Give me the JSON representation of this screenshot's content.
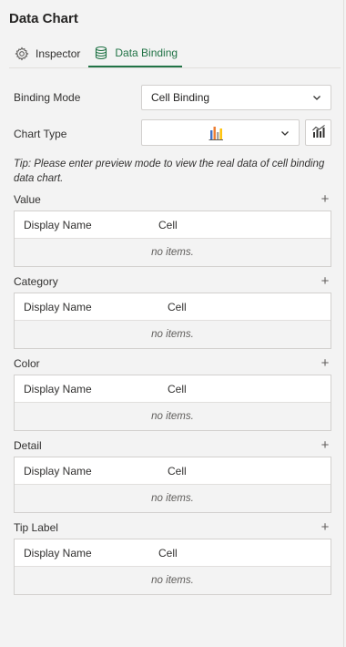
{
  "panel": {
    "title": "Data Chart",
    "tabs": [
      {
        "label": "Inspector",
        "icon": "gear-icon",
        "active": false
      },
      {
        "label": "Data Binding",
        "icon": "database-icon",
        "active": true
      }
    ]
  },
  "binding_mode": {
    "label": "Binding Mode",
    "value": "Cell Binding"
  },
  "chart_type": {
    "label": "Chart Type",
    "value_icon": "bar-chart-icon",
    "button_icon": "combo-chart-icon"
  },
  "tip": "Tip: Please enter preview mode to view the real data of cell binding data chart.",
  "sections": [
    {
      "label": "Value",
      "col1": "Display Name",
      "col2": "Cell",
      "empty": "no items."
    },
    {
      "label": "Category",
      "col1": "Display Name",
      "col2": "Cell",
      "empty": "no items."
    },
    {
      "label": "Color",
      "col1": "Display Name",
      "col2": "Cell",
      "empty": "no items."
    },
    {
      "label": "Detail",
      "col1": "Display Name",
      "col2": "Cell",
      "empty": "no items."
    },
    {
      "label": "Tip Label",
      "col1": "Display Name",
      "col2": "Cell",
      "empty": "no items."
    }
  ],
  "colors": {
    "accent": "#217346",
    "border": "#d2d0ce",
    "background": "#f3f3f3"
  }
}
